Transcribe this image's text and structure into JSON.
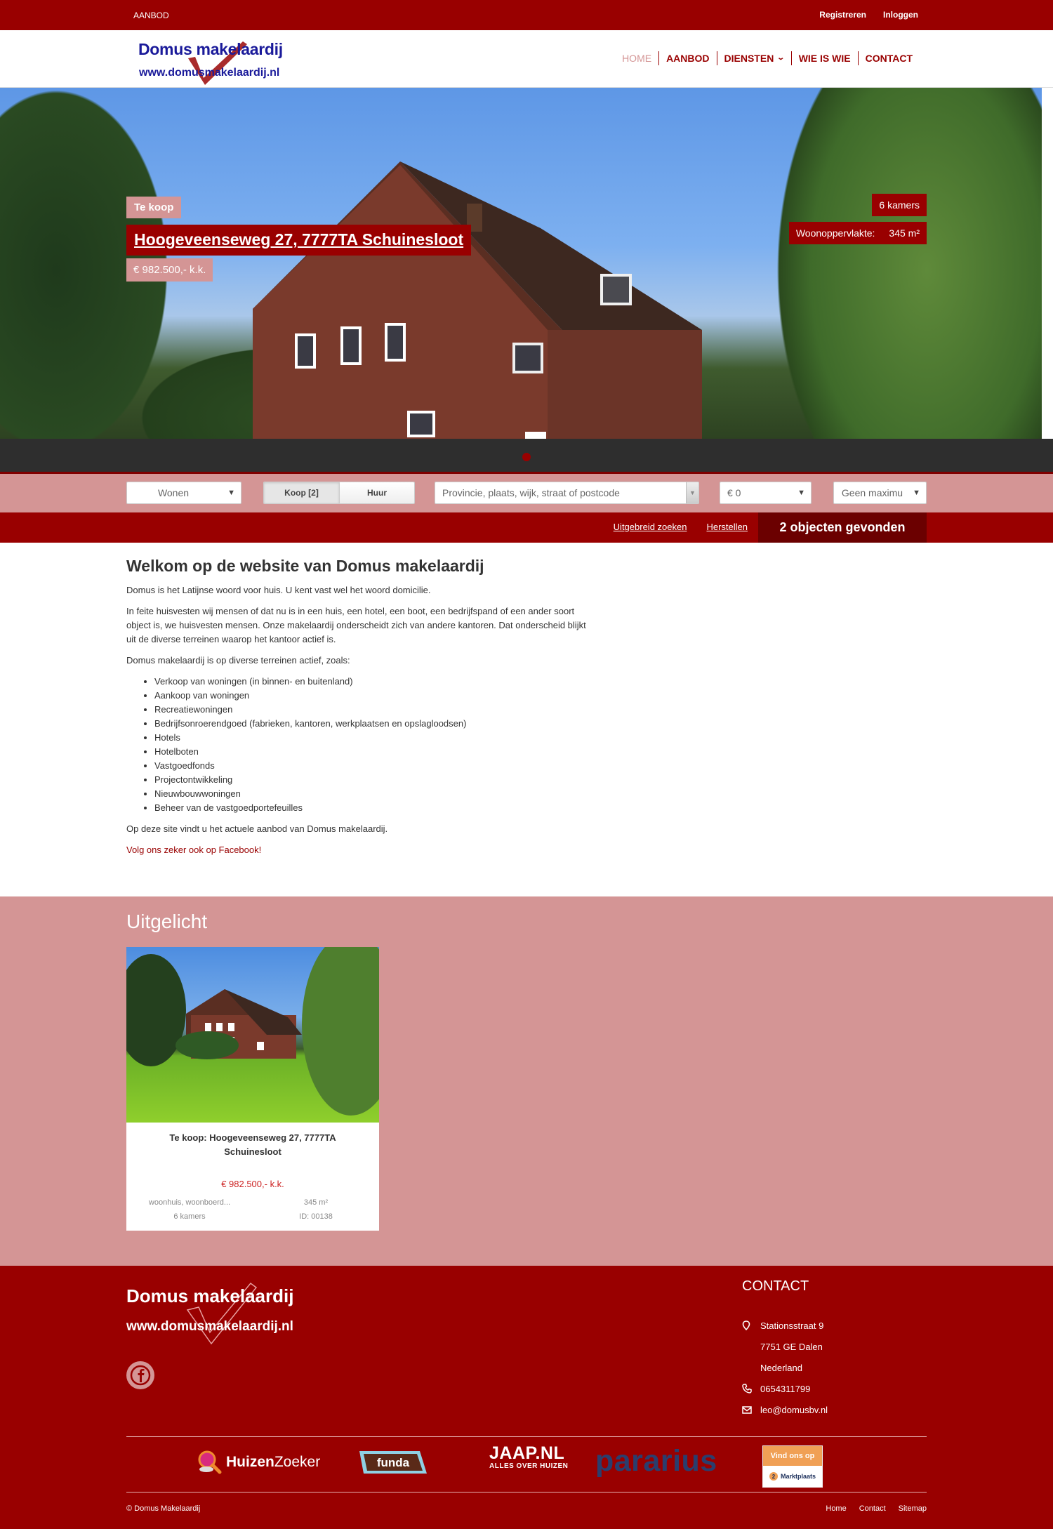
{
  "topbar": {
    "left_link": "AANBOD",
    "register": "Registreren",
    "login": "Inloggen"
  },
  "header": {
    "logo_name": "Domus makelaardij",
    "logo_url": "www.domusmakelaardij.nl",
    "nav": [
      {
        "label": "HOME",
        "active": true
      },
      {
        "label": "AANBOD"
      },
      {
        "label": "DIENSTEN",
        "has_dropdown": true
      },
      {
        "label": "WIE IS WIE"
      },
      {
        "label": "CONTACT"
      }
    ]
  },
  "hero": {
    "status": "Te koop",
    "address": "Hoogeveenseweg 27, 7777TA Schuinesloot",
    "price": "€ 982.500,- k.k.",
    "rooms": "6 kamers",
    "area_label": "Woonoppervlakte:",
    "area_value": "345 m²",
    "slide_count": 1,
    "active_slide": 1
  },
  "search": {
    "type_value": "Wonen",
    "segment": [
      {
        "label": "Koop [2]",
        "active": true
      },
      {
        "label": "Huur",
        "active": false
      }
    ],
    "location_placeholder": "Provincie, plaats, wijk, straat of postcode",
    "min_price": "€ 0",
    "max_price": "Geen maximum",
    "max_price_visible": "Geen maximu",
    "advanced_link": "Uitgebreid zoeken",
    "reset_link": "Herstellen",
    "result_count": "2 objecten gevonden"
  },
  "content": {
    "title": "Welkom op de website van Domus makelaardij",
    "p1": "Domus is het Latijnse woord voor huis. U kent vast wel het woord domicilie.",
    "p2": "In feite huisvesten wij mensen of dat nu is in een huis, een hotel, een boot, een bedrijfspand of een ander soort object is, we huisvesten mensen. Onze makelaardij onderscheidt zich van andere kantoren. Dat onderscheid blijkt uit de diverse terreinen waarop het kantoor actief is.",
    "p3": "Domus makelaardij is op diverse terreinen actief, zoals:",
    "list": [
      "Verkoop van woningen (in binnen- en buitenland)",
      "Aankoop van woningen",
      "Recreatiewoningen",
      "Bedrijfsonroerendgoed (fabrieken, kantoren, werkplaatsen en opslagloodsen)",
      "Hotels",
      "Hotelboten",
      "Vastgoedfonds",
      "Projectontwikkeling",
      "Nieuwbouwwoningen",
      "Beheer van de vastgoedportefeuilles"
    ],
    "p4": "Op deze site vindt u het actuele aanbod van Domus makelaardij.",
    "facebook_link": "Volg ons zeker ook op Facebook!"
  },
  "featured": {
    "title": "Uitgelicht",
    "card": {
      "title": "Te koop: Hoogeveenseweg 27, 7777TA Schuinesloot",
      "price": "€ 982.500,- k.k.",
      "type": "woonhuis, woonboerd...",
      "area": "345 m²",
      "rooms": "6 kamers",
      "id": "ID: 00138"
    }
  },
  "footer": {
    "logo_name": "Domus makelaardij",
    "logo_url": "www.domusmakelaardij.nl",
    "contact_title": "CONTACT",
    "street": "Stationsstraat 9",
    "city": "7751 GE Dalen",
    "country": "Nederland",
    "phone": "0654311799",
    "email": "leo@domusbv.nl",
    "partners": {
      "huizenzoeker_a": "Huizen",
      "huizenzoeker_b": "Zoeker",
      "funda": "funda",
      "jaap_1": "JAAP.NL",
      "jaap_2": "ALLES OVER HUIZEN",
      "pararius": "pararius",
      "marktplaats_top": "Vind ons op",
      "marktplaats_bot": "Marktplaats",
      "marktplaats_num": "2"
    },
    "copyright": "© Domus Makelaardij",
    "links": [
      "Home",
      "Contact",
      "Sitemap"
    ]
  },
  "colors": {
    "brand_red": "#990000",
    "dark_red": "#6b0000",
    "pink": "#d49595",
    "logo_blue": "#1a1a9a",
    "price_red": "#cc2222"
  }
}
